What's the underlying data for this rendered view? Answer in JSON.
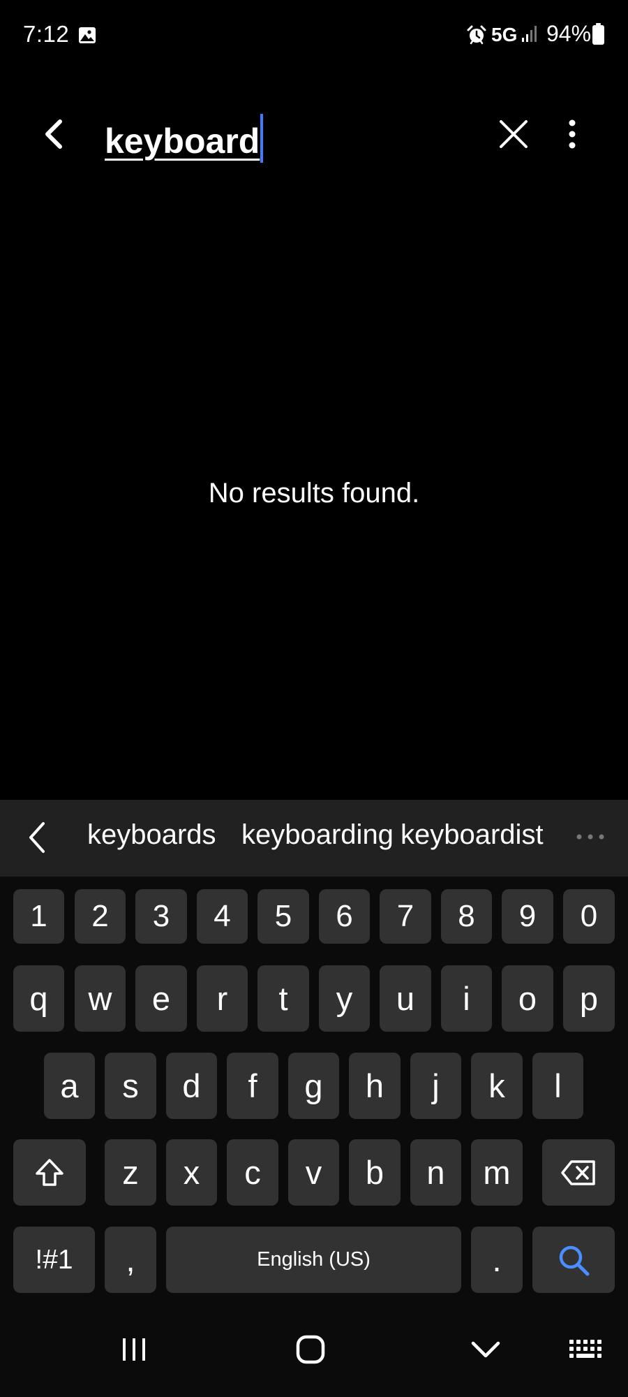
{
  "status_bar": {
    "time": "7:12",
    "network": "5G",
    "battery": "94%",
    "icons": [
      "gallery-icon",
      "alarm-icon",
      "signal-icon",
      "battery-icon"
    ]
  },
  "search": {
    "query": "keyboard",
    "icons": [
      "back-arrow-icon",
      "close-icon",
      "more-vert-icon"
    ]
  },
  "results": {
    "empty_message": "No results found."
  },
  "keyboard": {
    "suggestions": [
      "keyboards",
      "keyboarding",
      "keyboardist"
    ],
    "digits": [
      "1",
      "2",
      "3",
      "4",
      "5",
      "6",
      "7",
      "8",
      "9",
      "0"
    ],
    "row1": [
      "q",
      "w",
      "e",
      "r",
      "t",
      "y",
      "u",
      "i",
      "o",
      "p"
    ],
    "row2": [
      "a",
      "s",
      "d",
      "f",
      "g",
      "h",
      "j",
      "k",
      "l"
    ],
    "row3": [
      "z",
      "x",
      "c",
      "v",
      "b",
      "n",
      "m"
    ],
    "symbols_label": "!#1",
    "comma": ",",
    "space_label": "English (US)",
    "period": ".",
    "accent_color": "#4a8eff",
    "icons": [
      "chevron-left-icon",
      "more-horiz-icon",
      "shift-icon",
      "backspace-icon",
      "search-icon"
    ]
  },
  "nav_bar": {
    "icons": [
      "recents-icon",
      "home-icon",
      "hide-keyboard-icon",
      "keyboard-switch-icon"
    ]
  }
}
